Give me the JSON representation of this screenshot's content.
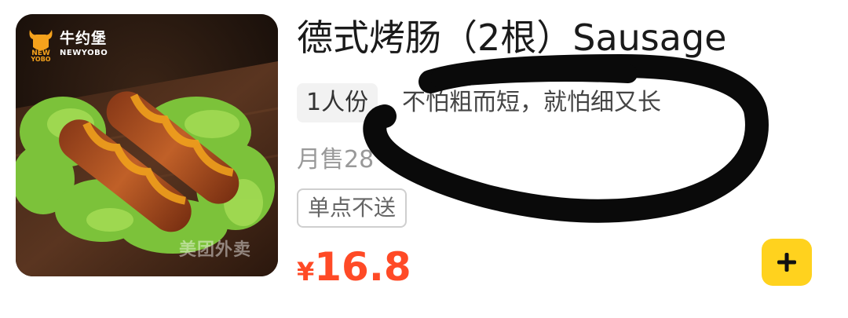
{
  "product": {
    "brand_name_cn": "牛约堡",
    "brand_name_en": "NEWYOBO",
    "brand_badge_text": "NEW YOBO",
    "watermark": "美团外卖",
    "title": "德式烤肠（2根）Sausage",
    "serving": "1人份",
    "slogan": "不怕粗而短，就怕细又长",
    "monthly_sales": "月售28",
    "delivery_tag": "单点不送",
    "price_symbol": "¥",
    "price": "16.8",
    "add_button_icon": "plus-icon"
  },
  "colors": {
    "price": "#ff4a26",
    "add_button": "#ffd21e",
    "tag_background": "#f2f2f2",
    "scribble": "#0a0a0a"
  }
}
